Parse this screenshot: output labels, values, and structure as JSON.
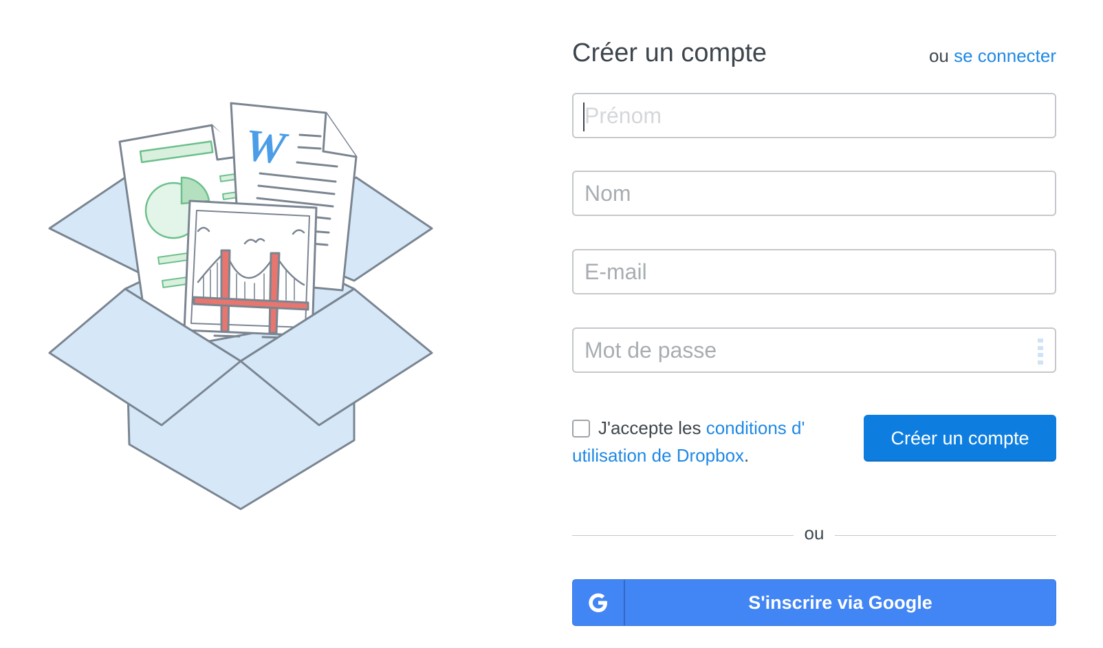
{
  "header": {
    "title": "Créer un compte",
    "signin_prefix": "ou",
    "signin_link": "se connecter"
  },
  "fields": {
    "first_name": {
      "placeholder": "Prénom",
      "value": ""
    },
    "last_name": {
      "placeholder": "Nom",
      "value": ""
    },
    "email": {
      "placeholder": "E-mail",
      "value": ""
    },
    "password": {
      "placeholder": "Mot de passe",
      "value": ""
    }
  },
  "terms": {
    "prefix": "J'accepte les",
    "link": "conditions d' utilisation de Dropbox",
    "suffix": "."
  },
  "create_button": "Créer un compte",
  "divider_label": "ou",
  "google_button": "S'inscrire via Google",
  "colors": {
    "link": "#1e88e5",
    "primary_button": "#0d7ee0",
    "google_button": "#4285f4",
    "box_fill": "#d6e8f8",
    "stroke": "#7a8591",
    "chart_green": "#6cc08b",
    "bridge_red": "#e8766e",
    "word_blue": "#4a9de6"
  },
  "icons": {
    "google": "google-g-icon",
    "illustration": "dropbox-box-illustration"
  }
}
